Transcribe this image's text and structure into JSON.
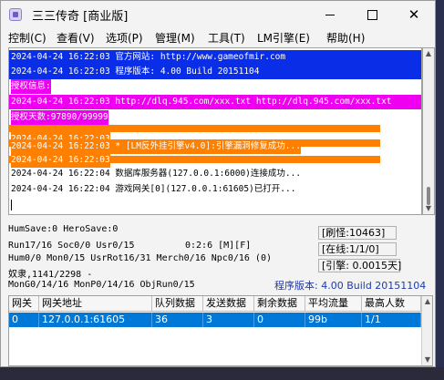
{
  "window": {
    "title": "三三传奇 [商业版]",
    "minimize_glyph": "—",
    "maximize_glyph": "□",
    "close_glyph": "✕"
  },
  "menu": [
    {
      "label": "控制(C)"
    },
    {
      "label": "查看(V)"
    },
    {
      "label": "选项(P)"
    },
    {
      "label": "管理(M)"
    },
    {
      "label": "工具(T)"
    },
    {
      "label": "LM引擎(E)"
    },
    {
      "label": "帮助(H)"
    }
  ],
  "log": [
    {
      "text": "2024-04-24 16:22:03 官方网站: http://www.gameofmir.com",
      "style": "blue"
    },
    {
      "text": "2024-04-24 16:22:03 程序版本: 4.00 Build 20151104",
      "style": "blue"
    },
    {
      "text": "授权信息:",
      "style": "magenta"
    },
    {
      "text": "2024-04-24 16:22:03 http://dlq.945.com/xxx.txt http://dlq.945.com/xxx.txt",
      "style": "magenta-full"
    },
    {
      "text": "授权天数:97890/99999",
      "style": "magenta"
    },
    {
      "text": "2024-04-24 16:22:03 ",
      "style": "orange"
    },
    {
      "text": "2024-04-24 16:22:03 * [LM反外挂引擎v4.0]:引擎漏洞修复成功...",
      "style": "orange"
    },
    {
      "text": "2024-04-24 16:22:03 ",
      "style": "orange"
    },
    {
      "text": "2024-04-24 16:22:04 数据库服务器(127.0.0.1:6000)连接成功...",
      "style": "normal"
    },
    {
      "text": "2024-04-24 16:22:04 游戏网关[0](127.0.0.1:61605)已打开...",
      "style": "normal"
    }
  ],
  "stats": {
    "line1": "HumSave:0 HeroSave:0",
    "line2": "Run17/16 Soc0/0 Usr0/15",
    "line2_mid": "0:2:6 [M][F]",
    "line3": "Hum0/0 Mon0/15 UsrRot16/31 Merch0/16 Npc0/16 (0)",
    "line4": "奴隶,1141/2298 -",
    "line5": "MonG0/14/16 MonP0/14/16 ObjRun0/15",
    "refresh": "[刷怪:10463]",
    "online": "[在线:1/1/0]",
    "engine": "[引擎: 0.0015天]",
    "version": "程序版本: 4.00 Build 20151104"
  },
  "gateway_table": {
    "columns": [
      "网关",
      "网关地址",
      "队列数据",
      "发送数据",
      "剩余数据",
      "平均流量",
      "最高人数"
    ],
    "rows": [
      [
        "0",
        "127.0.0.1:61605",
        "36",
        "3",
        "0",
        "99b",
        "1/1"
      ]
    ]
  },
  "icons": {
    "scroll_up": "up-arrow-icon",
    "scroll_down": "down-arrow-icon",
    "app": "app-icon"
  }
}
